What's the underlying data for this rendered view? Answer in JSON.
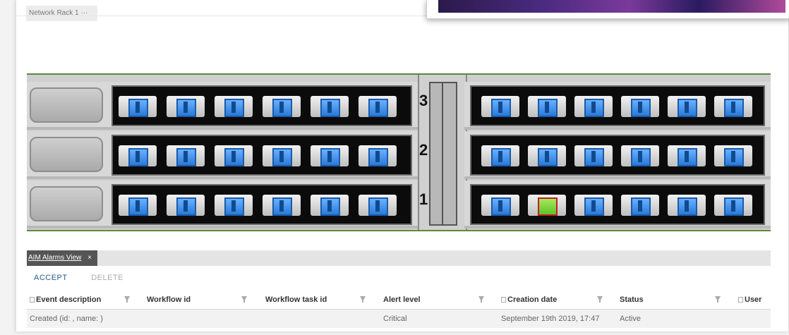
{
  "top_tab": {
    "label": "Network Rack 1 ···"
  },
  "rack": {
    "slot_labels": [
      "3",
      "2",
      "1"
    ]
  },
  "alarms": {
    "tab_label": "AIM Alarms View",
    "close_glyph": "×",
    "accept_label": "ACCEPT",
    "delete_label": "DELETE",
    "columns": [
      "Event description",
      "Workflow id",
      "Workflow task id",
      "Alert level",
      "Creation date",
      "Status",
      "User"
    ],
    "rows": [
      {
        "event_description": "Created (id: , name: )",
        "workflow_id": "",
        "workflow_task_id": "",
        "alert_level": "Critical",
        "creation_date": "September 19th 2019, 17:47",
        "status": "Active",
        "user": ""
      }
    ]
  },
  "colors": {
    "alert_port": "#5cc22a",
    "alert_border": "#c02020",
    "port_blue": "#2a7ad8"
  }
}
